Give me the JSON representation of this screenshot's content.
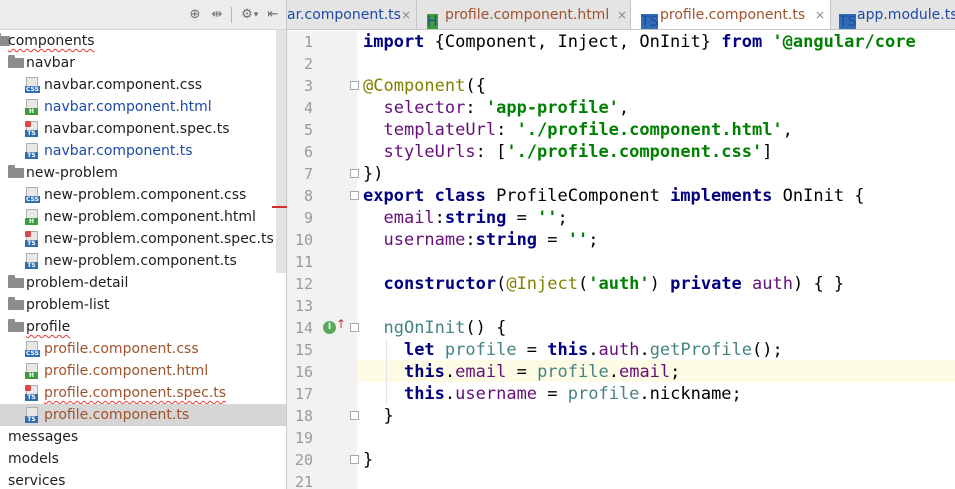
{
  "toolbar": {
    "icons": [
      "target-icon",
      "collapse-icon",
      "gear-icon",
      "hide-icon"
    ],
    "glyphs": {
      "target": "⊕",
      "collapse": "⇹",
      "gear": "⚙",
      "caret": "▾",
      "hide": "⇤"
    }
  },
  "tree": {
    "items": [
      {
        "label": "components",
        "kind": "folder-root",
        "error": true
      },
      {
        "label": "navbar",
        "kind": "folder"
      },
      {
        "label": "navbar.component.css",
        "kind": "file",
        "type": "CSS",
        "color": "#1e1e1e"
      },
      {
        "label": "navbar.component.html",
        "kind": "file",
        "type": "HTML",
        "color": "#1d4aa7"
      },
      {
        "label": "navbar.component.spec.ts",
        "kind": "file",
        "type": "SPEC",
        "color": "#1e1e1e"
      },
      {
        "label": "navbar.component.ts",
        "kind": "file",
        "type": "TS",
        "color": "#1d4aa7"
      },
      {
        "label": "new-problem",
        "kind": "folder"
      },
      {
        "label": "new-problem.component.css",
        "kind": "file",
        "type": "CSS",
        "color": "#1e1e1e"
      },
      {
        "label": "new-problem.component.html",
        "kind": "file",
        "type": "HTML",
        "color": "#1e1e1e"
      },
      {
        "label": "new-problem.component.spec.ts",
        "kind": "file",
        "type": "SPEC",
        "color": "#1e1e1e"
      },
      {
        "label": "new-problem.component.ts",
        "kind": "file",
        "type": "TS",
        "color": "#1e1e1e"
      },
      {
        "label": "problem-detail",
        "kind": "folder"
      },
      {
        "label": "problem-list",
        "kind": "folder"
      },
      {
        "label": "profile",
        "kind": "folder",
        "error": true
      },
      {
        "label": "profile.component.css",
        "kind": "file",
        "type": "CSS",
        "color": "#a0522d"
      },
      {
        "label": "profile.component.html",
        "kind": "file",
        "type": "HTML",
        "color": "#a0522d"
      },
      {
        "label": "profile.component.spec.ts",
        "kind": "file",
        "type": "SPEC",
        "color": "#a0522d",
        "error": true
      },
      {
        "label": "profile.component.ts",
        "kind": "file",
        "type": "TS",
        "color": "#a0522d",
        "selected": true
      },
      {
        "label": "messages",
        "kind": "folder-root"
      },
      {
        "label": "models",
        "kind": "folder-root"
      },
      {
        "label": "services",
        "kind": "folder-root"
      }
    ]
  },
  "tabs": [
    {
      "label": "ar.component.ts",
      "type": "TS",
      "color": "#1d4aa7",
      "close": "×"
    },
    {
      "label": "profile.component.html",
      "type": "HTML",
      "color": "#a0522d",
      "close": "×"
    },
    {
      "label": "profile.component.ts",
      "type": "TS",
      "color": "#a0522d",
      "close": "×",
      "active": true
    },
    {
      "label": "app.module.ts",
      "type": "TS",
      "color": "#1d4aa7"
    }
  ],
  "colors": {
    "keyword": "#000080",
    "string": "#008000",
    "decorator": "#808000",
    "property": "#660e7a",
    "variable": "#458383",
    "text": "#000000"
  },
  "editor": {
    "highlighted_line": 16,
    "override_icon": {
      "line": 14,
      "glyph": "I",
      "arrow": "↑"
    },
    "lines": [
      [
        [
          "kw",
          "import "
        ],
        [
          "t",
          "{Component, Inject, OnInit} "
        ],
        [
          "kw",
          "from "
        ],
        [
          "str",
          "'@angular/core"
        ]
      ],
      [],
      [
        [
          "dec",
          "@Component"
        ],
        [
          "t",
          "({"
        ]
      ],
      [
        [
          "t",
          "  "
        ],
        [
          "prop",
          "selector"
        ],
        [
          "t",
          ": "
        ],
        [
          "str",
          "'app-profile'"
        ],
        [
          "t",
          ","
        ]
      ],
      [
        [
          "t",
          "  "
        ],
        [
          "prop",
          "templateUrl"
        ],
        [
          "t",
          ": "
        ],
        [
          "str",
          "'./profile.component.html'"
        ],
        [
          "t",
          ","
        ]
      ],
      [
        [
          "t",
          "  "
        ],
        [
          "prop",
          "styleUrls"
        ],
        [
          "t",
          ": ["
        ],
        [
          "str",
          "'./profile.component.css'"
        ],
        [
          "t",
          "]"
        ]
      ],
      [
        [
          "t",
          "})"
        ]
      ],
      [
        [
          "kw",
          "export class "
        ],
        [
          "t",
          "ProfileComponent "
        ],
        [
          "kw",
          "implements "
        ],
        [
          "t",
          "OnInit {"
        ]
      ],
      [
        [
          "t",
          "  "
        ],
        [
          "prop",
          "email"
        ],
        [
          "t",
          ":"
        ],
        [
          "kw",
          "string "
        ],
        [
          "t",
          "= "
        ],
        [
          "str",
          "''"
        ],
        [
          "t",
          ";"
        ]
      ],
      [
        [
          "t",
          "  "
        ],
        [
          "prop",
          "username"
        ],
        [
          "t",
          ":"
        ],
        [
          "kw",
          "string "
        ],
        [
          "t",
          "= "
        ],
        [
          "str",
          "''"
        ],
        [
          "t",
          ";"
        ]
      ],
      [],
      [
        [
          "t",
          "  "
        ],
        [
          "kw",
          "constructor"
        ],
        [
          "t",
          "("
        ],
        [
          "dec",
          "@Inject"
        ],
        [
          "t",
          "("
        ],
        [
          "str",
          "'auth'"
        ],
        [
          "t",
          ") "
        ],
        [
          "kw",
          "private "
        ],
        [
          "prop",
          "auth"
        ],
        [
          "t",
          ") { }"
        ]
      ],
      [],
      [
        [
          "t",
          "  "
        ],
        [
          "var",
          "ngOnInit"
        ],
        [
          "t",
          "() {"
        ]
      ],
      [
        [
          "t",
          "    "
        ],
        [
          "kw",
          "let "
        ],
        [
          "var",
          "profile"
        ],
        [
          "t",
          " = "
        ],
        [
          "kw",
          "this"
        ],
        [
          "t",
          "."
        ],
        [
          "prop",
          "auth"
        ],
        [
          "t",
          "."
        ],
        [
          "var",
          "getProfile"
        ],
        [
          "t",
          "();"
        ]
      ],
      [
        [
          "t",
          "    "
        ],
        [
          "kw",
          "this"
        ],
        [
          "t",
          "."
        ],
        [
          "prop",
          "email"
        ],
        [
          "t",
          " = "
        ],
        [
          "var",
          "profile"
        ],
        [
          "t",
          "."
        ],
        [
          "prop",
          "email"
        ],
        [
          "t",
          ";"
        ]
      ],
      [
        [
          "t",
          "    "
        ],
        [
          "kw",
          "this"
        ],
        [
          "t",
          "."
        ],
        [
          "prop",
          "username"
        ],
        [
          "t",
          " = "
        ],
        [
          "var",
          "profile"
        ],
        [
          "t",
          ".nickname;"
        ]
      ],
      [
        [
          "t",
          "  }"
        ]
      ],
      [],
      [
        [
          "t",
          "}"
        ]
      ],
      []
    ],
    "line_numbers": [
      "1",
      "2",
      "3",
      "4",
      "5",
      "6",
      "7",
      "8",
      "9",
      "10",
      "11",
      "12",
      "13",
      "14",
      "15",
      "16",
      "17",
      "18",
      "19",
      "20",
      "21"
    ],
    "fold_lines": [
      3,
      7,
      8,
      14,
      18,
      20
    ]
  }
}
